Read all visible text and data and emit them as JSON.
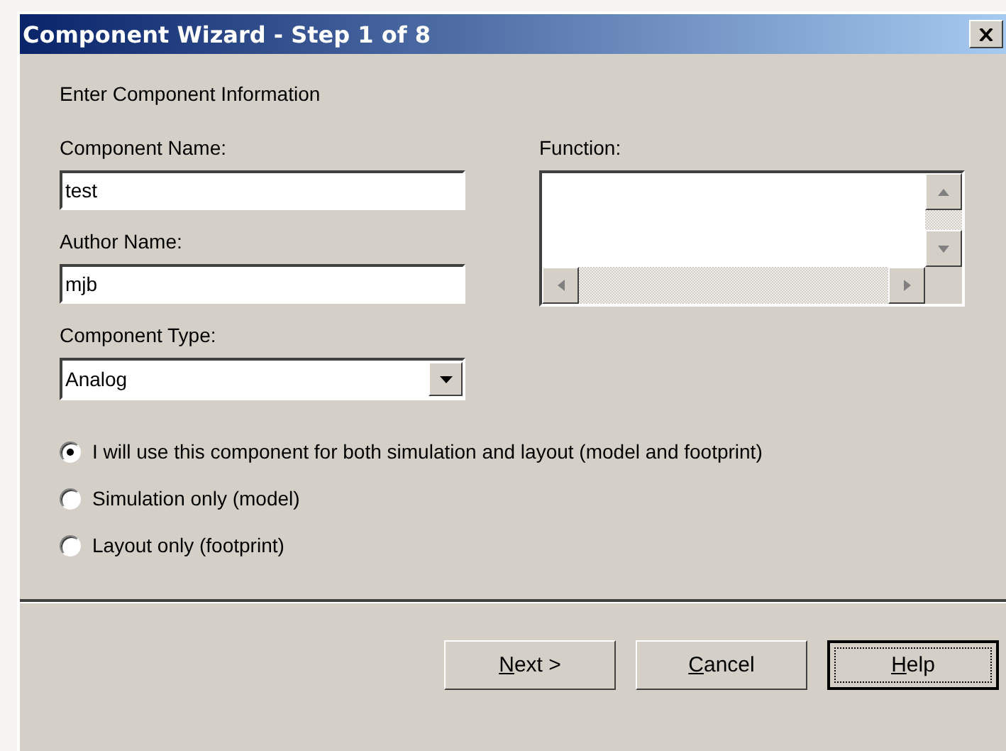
{
  "window": {
    "title": "Component Wizard - Step 1 of 8"
  },
  "heading": "Enter Component Information",
  "fields": {
    "component_name": {
      "label": "Component Name:",
      "value": "test"
    },
    "author_name": {
      "label": "Author Name:",
      "value": "mjb"
    },
    "component_type": {
      "label": "Component Type:",
      "value": "Analog"
    },
    "function": {
      "label": "Function:"
    }
  },
  "usage_options": [
    {
      "label": "I will use this component for both simulation and layout (model and footprint)",
      "selected": true
    },
    {
      "label": "Simulation only (model)",
      "selected": false
    },
    {
      "label": "Layout only (footprint)",
      "selected": false
    }
  ],
  "buttons": [
    {
      "mnemonic": "N",
      "label_rest": "ext >",
      "default": false
    },
    {
      "mnemonic": "C",
      "label_rest": "ancel",
      "default": false
    },
    {
      "mnemonic": "H",
      "label_rest": "elp",
      "default": true
    }
  ]
}
